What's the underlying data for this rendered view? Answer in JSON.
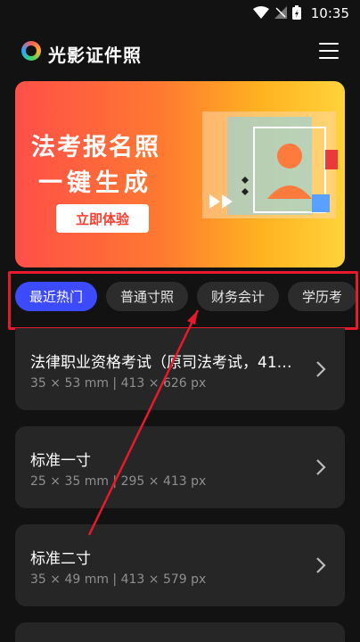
{
  "status_bar": {
    "time": "10:35"
  },
  "header": {
    "title": "光影证件照"
  },
  "banner": {
    "line1": "法考报名照",
    "line2": "一键生成",
    "button": "立即体验"
  },
  "tabs": [
    {
      "label": "最近热门",
      "active": true
    },
    {
      "label": "普通寸照",
      "active": false
    },
    {
      "label": "财务会计",
      "active": false
    },
    {
      "label": "学历考",
      "active": false
    }
  ],
  "items": [
    {
      "title": "法律职业资格考试（原司法考试，41…",
      "spec": "35 × 53 mm | 413 × 626 px"
    },
    {
      "title": "标准一寸",
      "spec": "25 × 35 mm | 295 × 413 px"
    },
    {
      "title": "标准二寸",
      "spec": "35 × 49 mm | 413 × 579 px"
    }
  ],
  "colors": {
    "active_tab": "#3d4bff",
    "highlight": "#e8192c",
    "banner_start": "#ff4f48",
    "banner_end": "#ffd33a"
  }
}
